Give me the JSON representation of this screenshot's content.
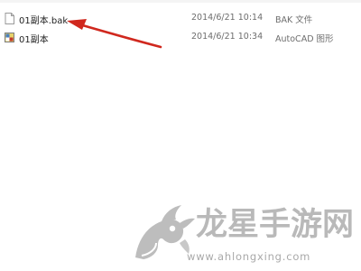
{
  "files": [
    {
      "name": "01副本.bak",
      "date": "2014/6/21 10:14",
      "type": "BAK 文件",
      "icon": "blank-file-icon"
    },
    {
      "name": "01副本",
      "date": "2014/6/21 10:34",
      "type": "AutoCAD 图形",
      "icon": "autocad-drawing-icon"
    }
  ],
  "annotation": {
    "arrow_color": "#d0281e",
    "arrow_icon": "red-arrow-icon"
  },
  "watermark": {
    "brand": "龙星手游网",
    "url": "www.ahlongxing.com",
    "logo_icon": "dragon-head-logo-icon",
    "color": "#b9b9b9"
  }
}
